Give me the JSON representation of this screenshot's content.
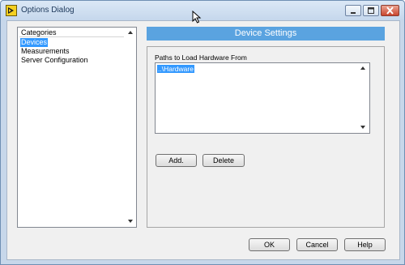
{
  "window": {
    "title": "Options Dialog"
  },
  "categories": {
    "header": "Categories",
    "items": [
      "Devices",
      "Measurements",
      "Server Configuration"
    ],
    "selected": "Devices"
  },
  "settings": {
    "header": "Device Settings",
    "paths_label": "Paths to Load Hardware From",
    "paths": [
      "..\\Hardware"
    ],
    "add_label": "Add.",
    "delete_label": "Delete"
  },
  "footer": {
    "ok_label": "OK",
    "cancel_label": "Cancel",
    "help_label": "Help"
  },
  "colors": {
    "accent": "#5aa3e0",
    "selection": "#3399ff",
    "titlebar": "#c5d7ec",
    "close": "#c9452e"
  }
}
